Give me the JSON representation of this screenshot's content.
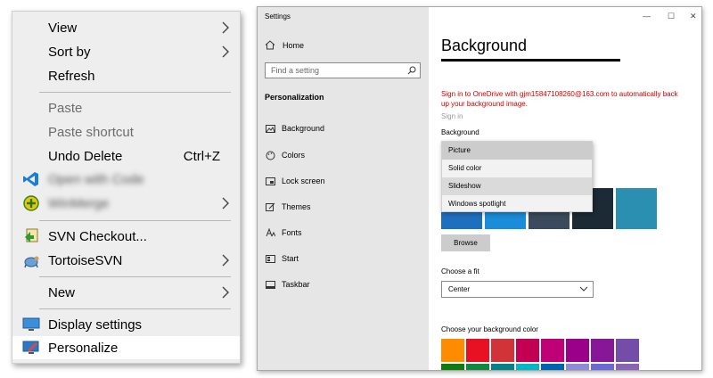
{
  "context_menu": {
    "items": [
      {
        "label": "View",
        "has_submenu": true
      },
      {
        "label": "Sort by",
        "has_submenu": true
      },
      {
        "label": "Refresh"
      },
      {
        "label": "Paste",
        "disabled": true
      },
      {
        "label": "Paste shortcut",
        "disabled": true
      },
      {
        "label": "Undo Delete",
        "shortcut": "Ctrl+Z"
      },
      {
        "label": "Open with Code",
        "icon": "vscode-icon",
        "blurred": true
      },
      {
        "label": "WinMerge",
        "icon": "add-icon",
        "blurred": true,
        "has_submenu": true
      },
      {
        "label": "SVN Checkout...",
        "icon": "svn-checkout-icon"
      },
      {
        "label": "TortoiseSVN",
        "icon": "tortoisesvn-icon",
        "has_submenu": true
      },
      {
        "label": "New",
        "has_submenu": true
      },
      {
        "label": "Display settings",
        "icon": "display-icon"
      },
      {
        "label": "Personalize",
        "icon": "personalize-icon",
        "highlighted": true
      }
    ]
  },
  "settings": {
    "window_title": "Settings",
    "home_label": "Home",
    "search_placeholder": "Find a setting",
    "section_title": "Personalization",
    "nav_items": [
      {
        "label": "Background",
        "icon": "image-icon"
      },
      {
        "label": "Colors",
        "icon": "palette-icon"
      },
      {
        "label": "Lock screen",
        "icon": "lock-screen-icon"
      },
      {
        "label": "Themes",
        "icon": "themes-icon"
      },
      {
        "label": "Fonts",
        "icon": "fonts-icon"
      },
      {
        "label": "Start",
        "icon": "start-icon"
      },
      {
        "label": "Taskbar",
        "icon": "taskbar-icon"
      }
    ],
    "page_title": "Background",
    "onedrive_warning": "Sign in to OneDrive with gjm15847108260@163.com to automatically back up your background image.",
    "sign_in_link": "Sign in",
    "background_label": "Background",
    "background_options": [
      "Picture",
      "Solid color",
      "Slideshow",
      "Windows spotlight"
    ],
    "browse_label": "Browse",
    "fit_label": "Choose a fit",
    "fit_value": "Center",
    "color_label": "Choose your background color",
    "window_controls": {
      "minimize": "—",
      "maximize": "☐",
      "close": "✕"
    },
    "swatch_colors": [
      "#ff8c00",
      "#e81123",
      "#d13438",
      "#c30052",
      "#bf0077",
      "#9a0089",
      "#881798",
      "#744da9",
      "#107c10",
      "#10893e",
      "#038387",
      "#00b7c3",
      "#0063b1",
      "#8e8cd8",
      "#6b69d6",
      "#8764b8"
    ],
    "thumb_colors": [
      "#1f6fbf",
      "#1a8cd8",
      "#3b4a5c",
      "#1c2a35",
      "#2a8fb0"
    ]
  }
}
